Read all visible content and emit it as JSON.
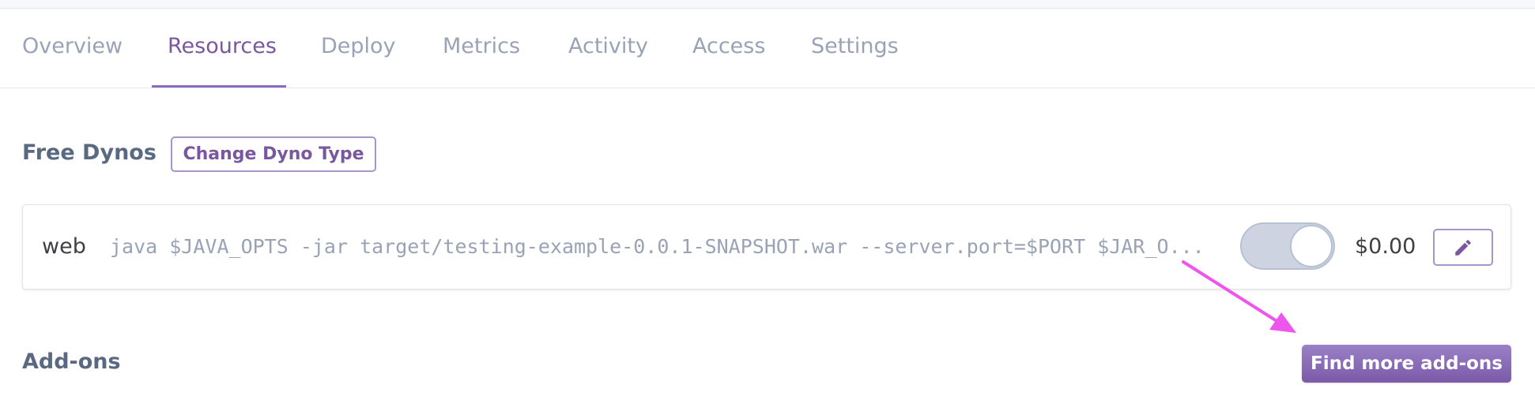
{
  "tabs": [
    {
      "label": "Overview",
      "active": false
    },
    {
      "label": "Resources",
      "active": true
    },
    {
      "label": "Deploy",
      "active": false
    },
    {
      "label": "Metrics",
      "active": false
    },
    {
      "label": "Activity",
      "active": false
    },
    {
      "label": "Access",
      "active": false
    },
    {
      "label": "Settings",
      "active": false
    }
  ],
  "dynos": {
    "title": "Free Dynos",
    "change_button": "Change Dyno Type",
    "process": {
      "name": "web",
      "command": "java $JAVA_OPTS -jar target/testing-example-0.0.1-SNAPSHOT.war --server.port=$PORT $JAR_O...",
      "enabled": false,
      "cost": "$0.00",
      "edit_icon": "pencil-icon"
    }
  },
  "addons": {
    "title": "Add-ons",
    "find_button": "Find more add-ons"
  },
  "annotation": {
    "arrow_icon": "annotation-arrow-icon",
    "color": "#ee55ee"
  },
  "colors": {
    "accent": "#79589f",
    "muted_text": "#9aa3b5",
    "heading": "#596981"
  }
}
